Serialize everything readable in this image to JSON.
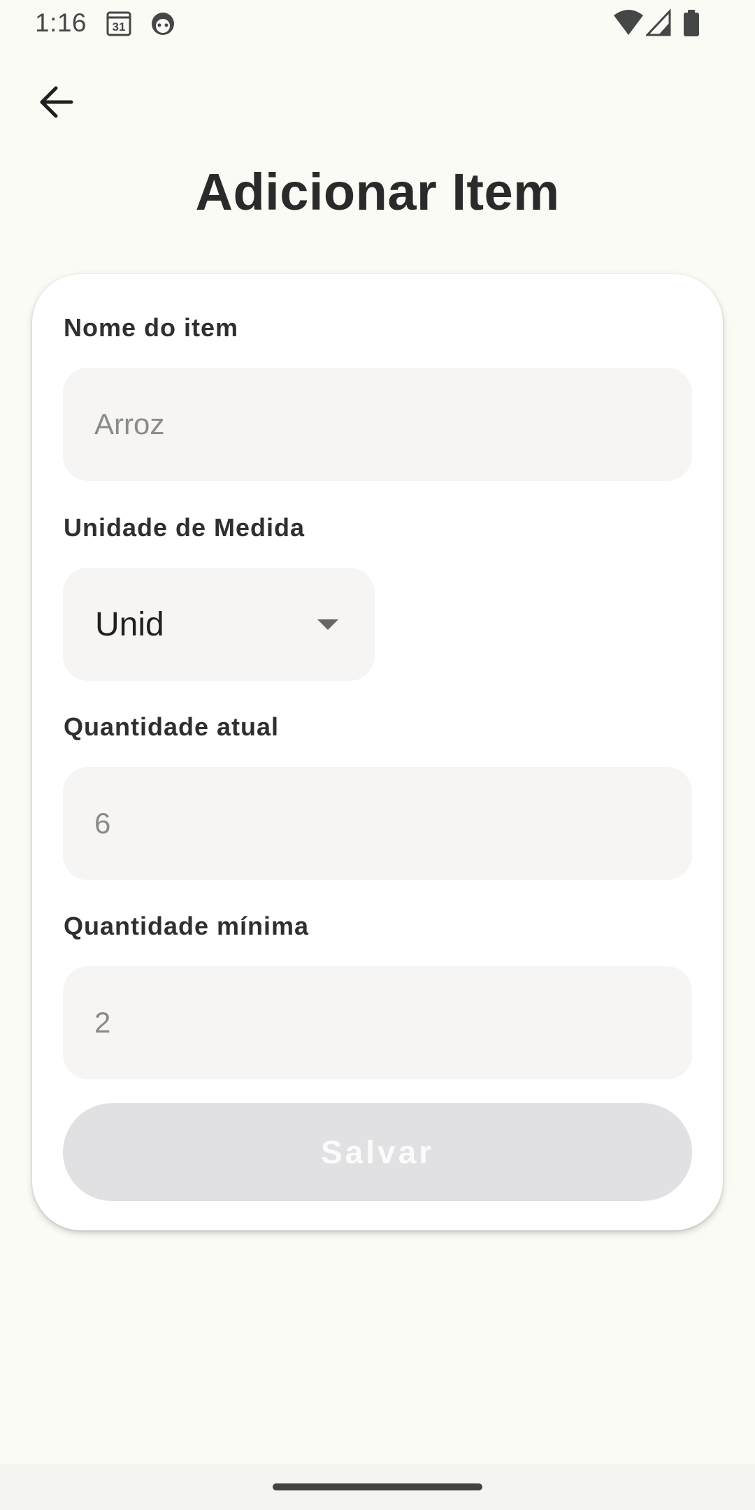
{
  "status_bar": {
    "time": "1:16",
    "calendar_day": "31",
    "icons": [
      "calendar-icon",
      "robot-icon",
      "wifi-icon",
      "signal-icon",
      "battery-icon"
    ]
  },
  "header": {
    "back_icon": "arrow-back-icon",
    "title": "Adicionar Item"
  },
  "form": {
    "name": {
      "label": "Nome do item",
      "placeholder": "Arroz",
      "value": ""
    },
    "unit": {
      "label": "Unidade de Medida",
      "selected": "Unid",
      "icon": "caret-down-icon"
    },
    "current_qty": {
      "label": "Quantidade atual",
      "placeholder": "6",
      "value": ""
    },
    "min_qty": {
      "label": "Quantidade mínima",
      "placeholder": "2",
      "value": ""
    },
    "save_label": "Salvar",
    "save_enabled": false
  },
  "colors": {
    "background": "#fbfbf5",
    "card": "#ffffff",
    "field_bg": "#f6f5f3",
    "button_disabled_bg": "#e1e0e3",
    "button_disabled_text": "#fbfbfb",
    "placeholder_text": "#8a8a8a"
  }
}
